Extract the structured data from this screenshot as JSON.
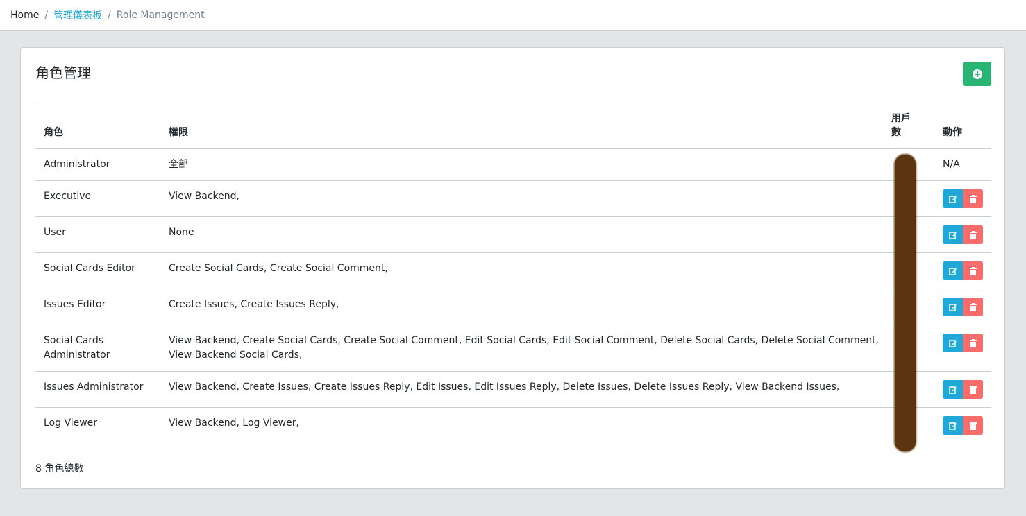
{
  "breadcrumb": {
    "home": "Home",
    "dashboard": "管理儀表板",
    "current": "Role Management",
    "separator": "/"
  },
  "card": {
    "title": "角色管理",
    "add_icon": "plus-circle-icon"
  },
  "table": {
    "headers": {
      "role": "角色",
      "permissions": "權限",
      "users_line1": "用戶",
      "users_line2": "數",
      "actions": "動作"
    },
    "rows": [
      {
        "role": "Administrator",
        "permissions": "全部",
        "action_text": "N/A"
      },
      {
        "role": "Executive",
        "permissions": "View Backend,"
      },
      {
        "role": "User",
        "permissions": "None"
      },
      {
        "role": "Social Cards Editor",
        "permissions": "Create Social Cards, Create Social Comment,"
      },
      {
        "role": "Issues Editor",
        "permissions": "Create Issues, Create Issues Reply,"
      },
      {
        "role": "Social Cards Administrator",
        "permissions": "View Backend, Create Social Cards, Create Social Comment, Edit Social Cards, Edit Social Comment, Delete Social Cards, Delete Social Comment, View Backend Social Cards,"
      },
      {
        "role": "Issues Administrator",
        "permissions": "View Backend, Create Issues, Create Issues Reply, Edit Issues, Edit Issues Reply, Delete Issues, Delete Issues Reply, View Backend Issues,"
      },
      {
        "role": "Log Viewer",
        "permissions": "View Backend, Log Viewer,"
      }
    ]
  },
  "footer": {
    "count_text": "8 角色總數"
  },
  "colors": {
    "accent": "#20a8d8",
    "success": "#28b473",
    "danger": "#f86c6b",
    "redaction": "#5a3510"
  }
}
